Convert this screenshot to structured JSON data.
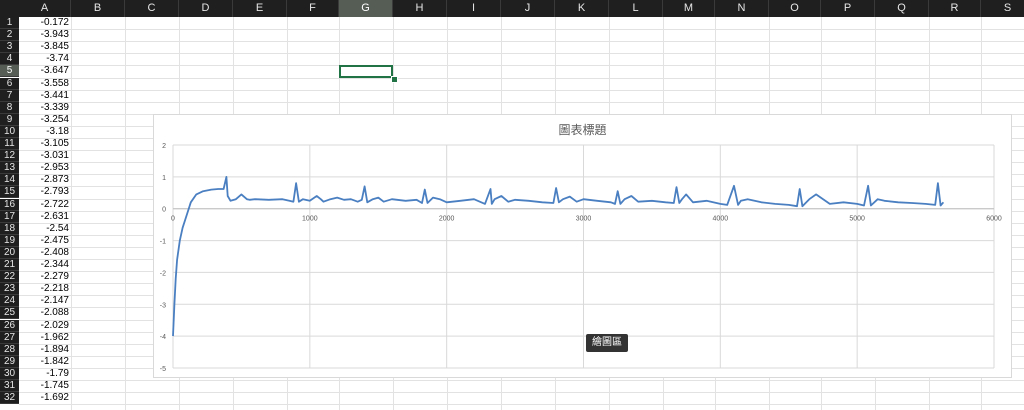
{
  "columns": [
    "A",
    "B",
    "C",
    "D",
    "E",
    "F",
    "G",
    "H",
    "I",
    "J",
    "K",
    "L",
    "M",
    "N",
    "O",
    "P",
    "Q",
    "R",
    "S"
  ],
  "selected_column": "G",
  "selected_row": "5",
  "rows": [
    "1",
    "2",
    "3",
    "4",
    "5",
    "6",
    "7",
    "8",
    "9",
    "10",
    "11",
    "12",
    "13",
    "14",
    "15",
    "16",
    "17",
    "18",
    "19",
    "20",
    "21",
    "22",
    "23",
    "24",
    "25",
    "26",
    "27",
    "28",
    "29",
    "30",
    "31",
    "32"
  ],
  "column_a_values": [
    "-0.172",
    "-3.943",
    "-3.845",
    "-3.74",
    "-3.647",
    "-3.558",
    "-3.441",
    "-3.339",
    "-3.254",
    "-3.18",
    "-3.105",
    "-3.031",
    "-2.953",
    "-2.873",
    "-2.793",
    "-2.722",
    "-2.631",
    "-2.54",
    "-2.475",
    "-2.408",
    "-2.344",
    "-2.279",
    "-2.218",
    "-2.147",
    "-2.088",
    "-2.029",
    "-1.962",
    "-1.894",
    "-1.842",
    "-1.79",
    "-1.745",
    "-1.692"
  ],
  "tooltip": "繪圖區",
  "chart_data": {
    "type": "line",
    "title": "圖表標題",
    "xlim": [
      0,
      6000
    ],
    "ylim": [
      -5,
      2
    ],
    "xticks": [
      "0",
      "1000",
      "2000",
      "3000",
      "4000",
      "5000",
      "6000"
    ],
    "yticks": [
      "2",
      "1",
      "0",
      "-1",
      "-2",
      "-3",
      "-4",
      "-5"
    ],
    "grid": true,
    "series_color": "#4a7fc1",
    "series": [
      {
        "x": [
          0,
          10,
          20,
          30,
          50,
          70,
          100,
          130,
          170,
          220,
          280,
          330,
          370,
          390,
          400,
          420,
          460,
          500,
          540,
          560,
          600,
          700,
          800,
          850,
          880,
          900,
          920,
          950,
          1000,
          1050,
          1080,
          1100,
          1150,
          1200,
          1250,
          1300,
          1350,
          1380,
          1400,
          1420,
          1460,
          1500,
          1540,
          1600,
          1700,
          1780,
          1820,
          1840,
          1860,
          1900,
          1950,
          2000,
          2100,
          2200,
          2280,
          2320,
          2330,
          2350,
          2400,
          2450,
          2500,
          2600,
          2700,
          2780,
          2800,
          2820,
          2850,
          2900,
          2950,
          3000,
          3100,
          3200,
          3230,
          3250,
          3270,
          3300,
          3350,
          3400,
          3500,
          3600,
          3660,
          3680,
          3700,
          3720,
          3750,
          3800,
          3900,
          4000,
          4050,
          4100,
          4130,
          4150,
          4200,
          4300,
          4400,
          4500,
          4560,
          4580,
          4600,
          4650,
          4700,
          4800,
          4900,
          5000,
          5050,
          5080,
          5100,
          5150,
          5200,
          5300,
          5400,
          5500,
          5570,
          5590,
          5610,
          5630
        ],
        "y": [
          -4,
          -3,
          -2.2,
          -1.6,
          -1.0,
          -0.6,
          -0.2,
          0.2,
          0.45,
          0.55,
          0.6,
          0.62,
          0.62,
          1.0,
          0.4,
          0.25,
          0.3,
          0.45,
          0.3,
          0.28,
          0.3,
          0.28,
          0.3,
          0.25,
          0.22,
          0.8,
          0.22,
          0.3,
          0.25,
          0.4,
          0.3,
          0.22,
          0.3,
          0.35,
          0.28,
          0.3,
          0.22,
          0.28,
          0.7,
          0.2,
          0.3,
          0.35,
          0.22,
          0.3,
          0.25,
          0.28,
          0.18,
          0.6,
          0.18,
          0.35,
          0.3,
          0.2,
          0.25,
          0.3,
          0.15,
          0.62,
          0.15,
          0.3,
          0.4,
          0.22,
          0.28,
          0.25,
          0.2,
          0.18,
          0.65,
          0.2,
          0.3,
          0.38,
          0.22,
          0.3,
          0.25,
          0.2,
          0.15,
          0.55,
          0.15,
          0.3,
          0.4,
          0.22,
          0.25,
          0.2,
          0.18,
          0.68,
          0.18,
          0.3,
          0.45,
          0.2,
          0.25,
          0.15,
          0.12,
          0.72,
          0.12,
          0.25,
          0.3,
          0.2,
          0.15,
          0.12,
          0.08,
          0.62,
          0.08,
          0.3,
          0.45,
          0.15,
          0.2,
          0.15,
          0.1,
          0.72,
          0.1,
          0.3,
          0.25,
          0.2,
          0.18,
          0.15,
          0.12,
          0.8,
          0.1,
          0.2
        ]
      }
    ]
  }
}
